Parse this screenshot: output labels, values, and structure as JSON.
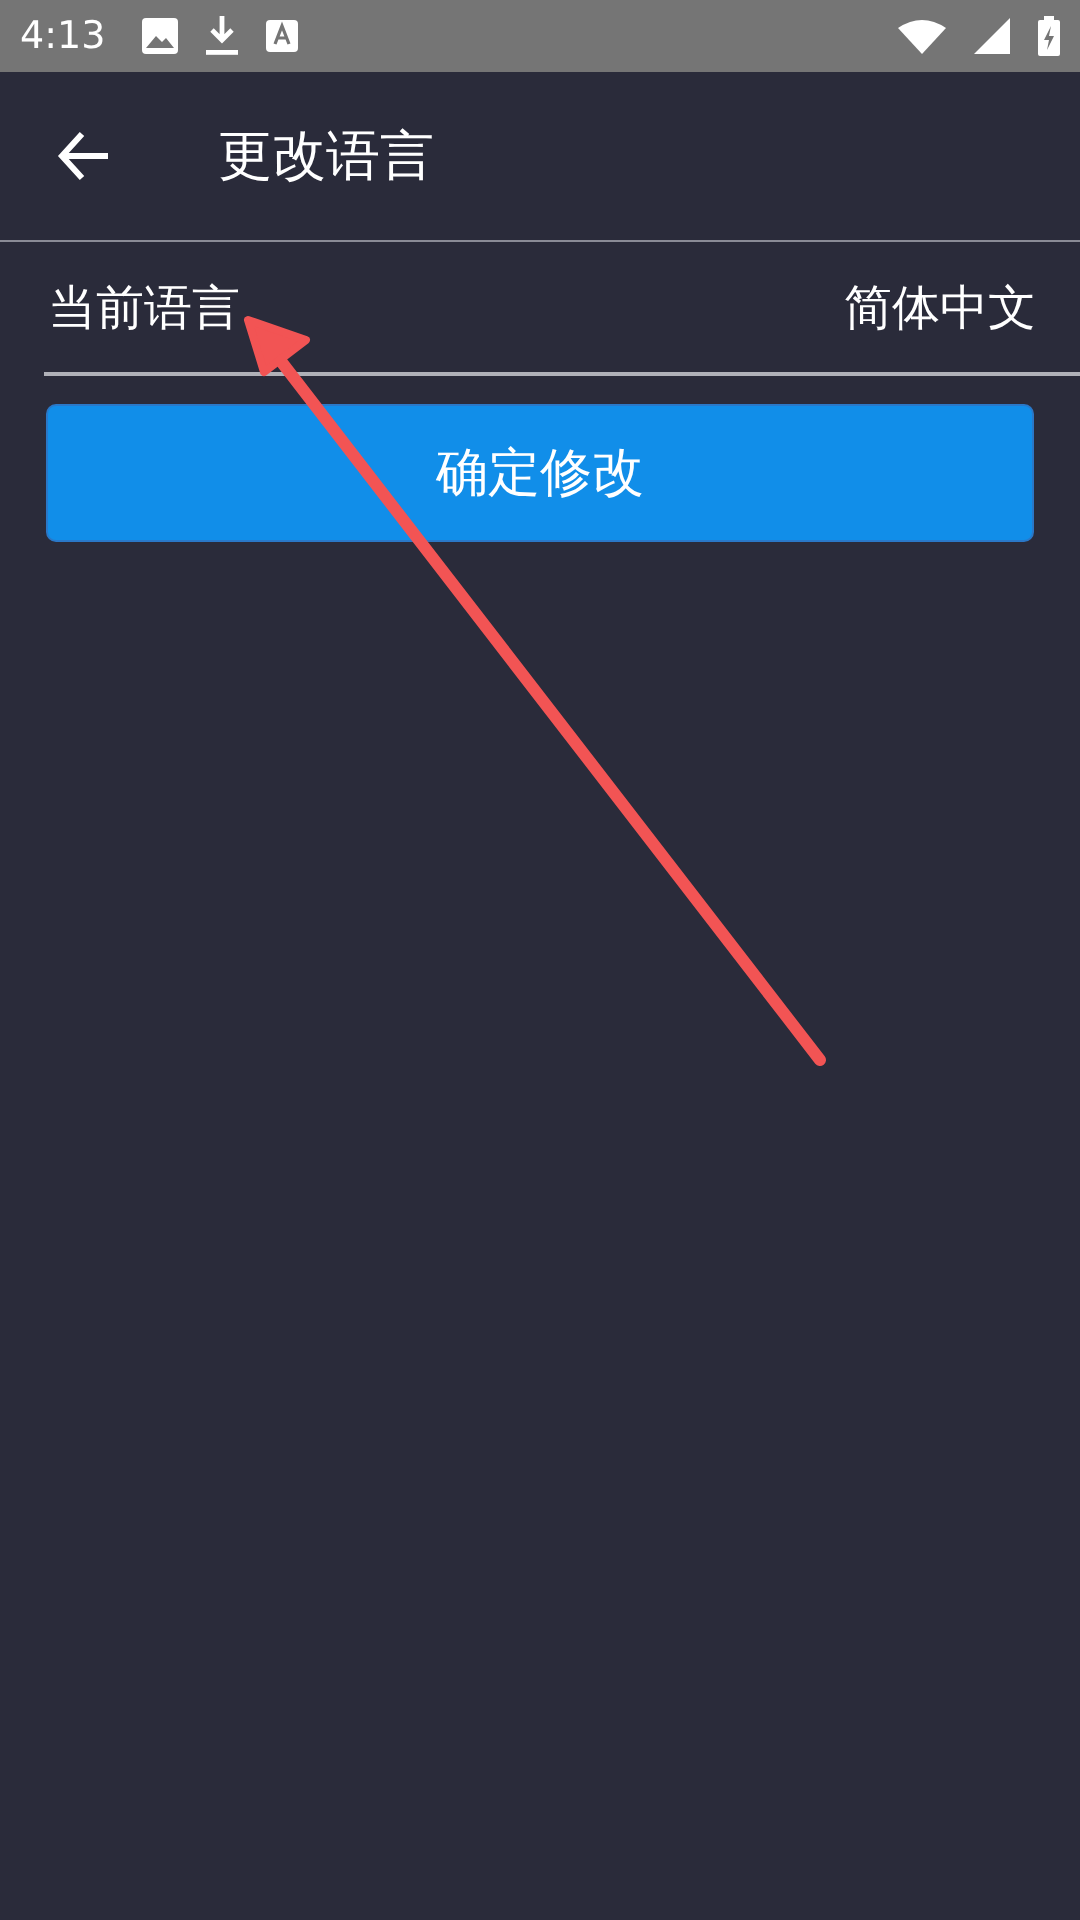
{
  "status_bar": {
    "time": "4:13"
  },
  "app_bar": {
    "title": "更改语言"
  },
  "setting_row": {
    "label": "当前语言",
    "value": "简体中文"
  },
  "confirm_button": {
    "label": "确定修改"
  }
}
